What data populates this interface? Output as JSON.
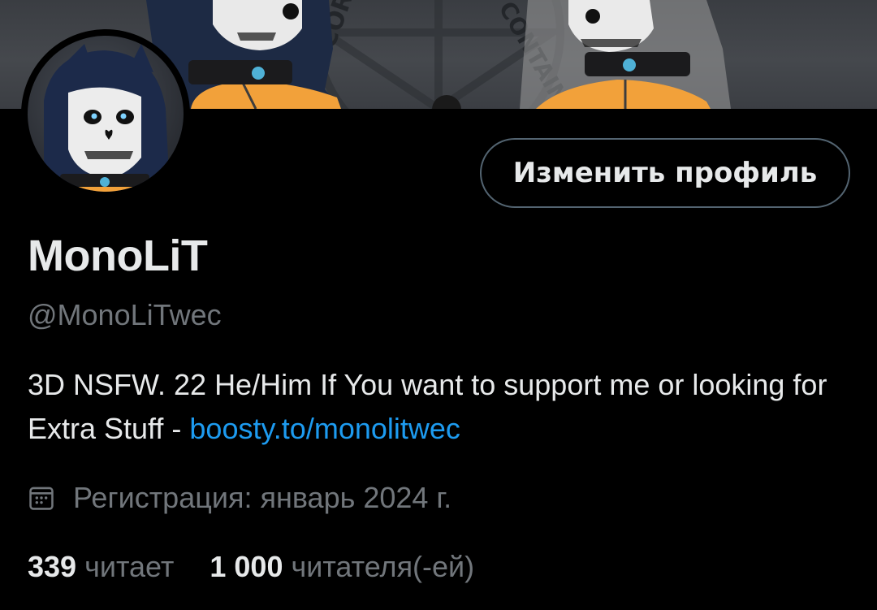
{
  "profile": {
    "display_name": "MonoLiT",
    "handle": "@MonoLiTwec",
    "bio_text": "3D NSFW. 22 He/Him  If You want to support me or looking for Extra Stuff  - ",
    "bio_link": "boosty.to/monolitwec",
    "joined": "Регистрация: январь 2024 г.",
    "edit_button": "Изменить профиль"
  },
  "stats": {
    "following_count": "339",
    "following_label": "читает",
    "followers_count": "1 000",
    "followers_label": "читателя(-ей)"
  },
  "banner": {
    "text_left": "CORE",
    "text_right": "CONTAIN"
  },
  "colors": {
    "background": "#000000",
    "text_primary": "#e7e9ea",
    "text_secondary": "#71767b",
    "link": "#1d9bf0",
    "button_border": "#536471",
    "suit_orange": "#f2a13a"
  },
  "icons": {
    "calendar": "calendar-icon"
  }
}
